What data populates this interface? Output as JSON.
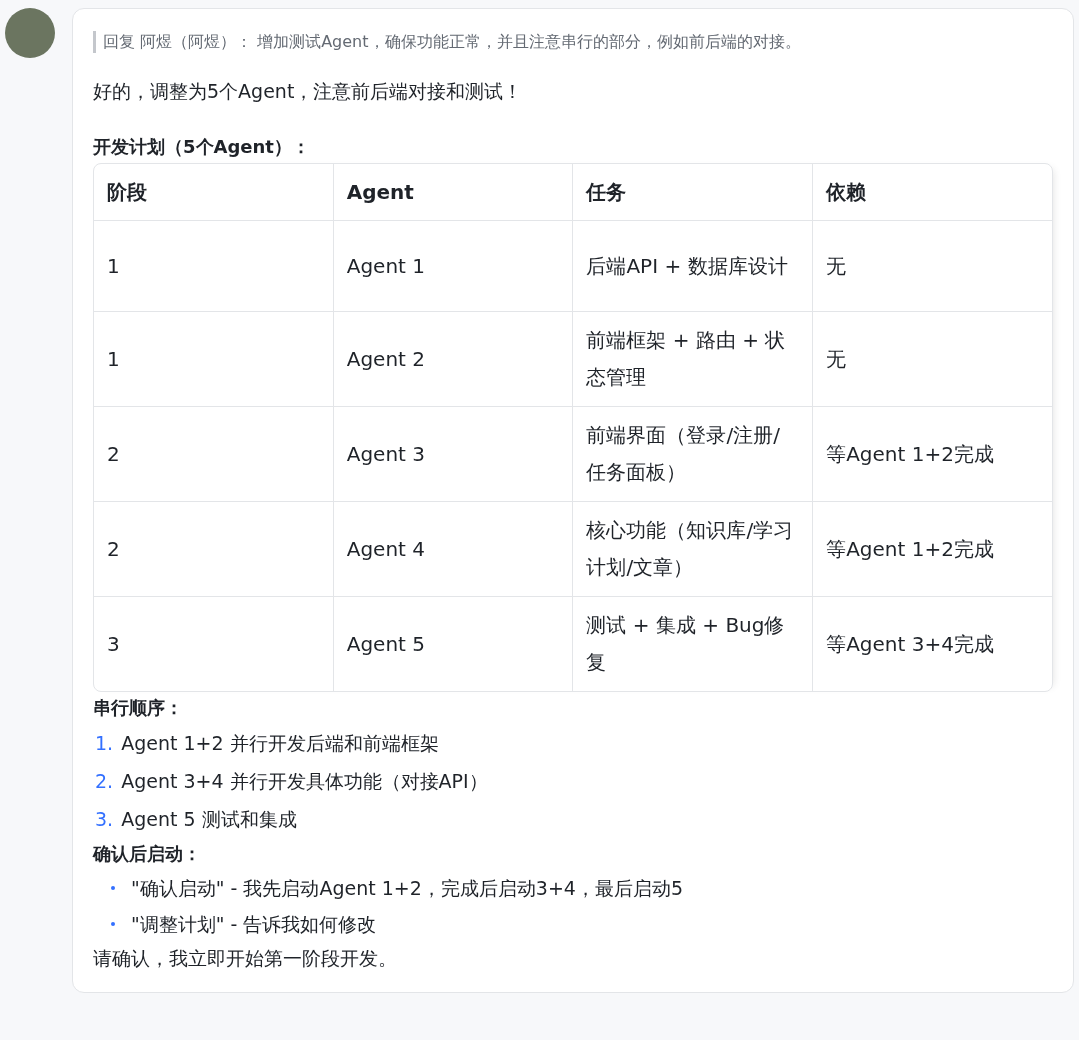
{
  "avatar": {
    "kind": "photo"
  },
  "message": {
    "quote": "回复 阿煜（阿煜）： 增加测试Agent，确保功能正常，并且注意串行的部分，例如前后端的对接。",
    "intro": "好的，调整为5个Agent，注意前后端对接和测试！",
    "plan_heading": "开发计划（5个Agent）：",
    "table": {
      "columns": [
        "阶段",
        "Agent",
        "任务",
        "依赖"
      ],
      "rows": [
        [
          "1",
          "Agent 1",
          "后端API + 数据库设计",
          "无"
        ],
        [
          "1",
          "Agent 2",
          "前端框架 + 路由 + 状态管理",
          "无"
        ],
        [
          "2",
          "Agent 3",
          "前端界面（登录/注册/任务面板）",
          "等Agent 1+2完成"
        ],
        [
          "2",
          "Agent 4",
          "核心功能（知识库/学习计划/文章）",
          "等Agent 1+2完成"
        ],
        [
          "3",
          "Agent 5",
          "测试 + 集成 + Bug修复",
          "等Agent 3+4完成"
        ]
      ]
    },
    "order_heading": "串行顺序：",
    "order": [
      {
        "marker": "1.",
        "text": "Agent 1+2 并行开发后端和前端框架"
      },
      {
        "marker": "2.",
        "text": "Agent 3+4 并行开发具体功能（对接API）"
      },
      {
        "marker": "3.",
        "text": "Agent 5 测试和集成"
      }
    ],
    "confirm_heading": "确认后启动：",
    "options": [
      "\"确认启动\" - 我先启动Agent 1+2，完成后启动3+4，最后启动5",
      "\"调整计划\" - 告诉我如何修改"
    ],
    "closing": "请确认，我立即开始第一阶段开发。"
  }
}
